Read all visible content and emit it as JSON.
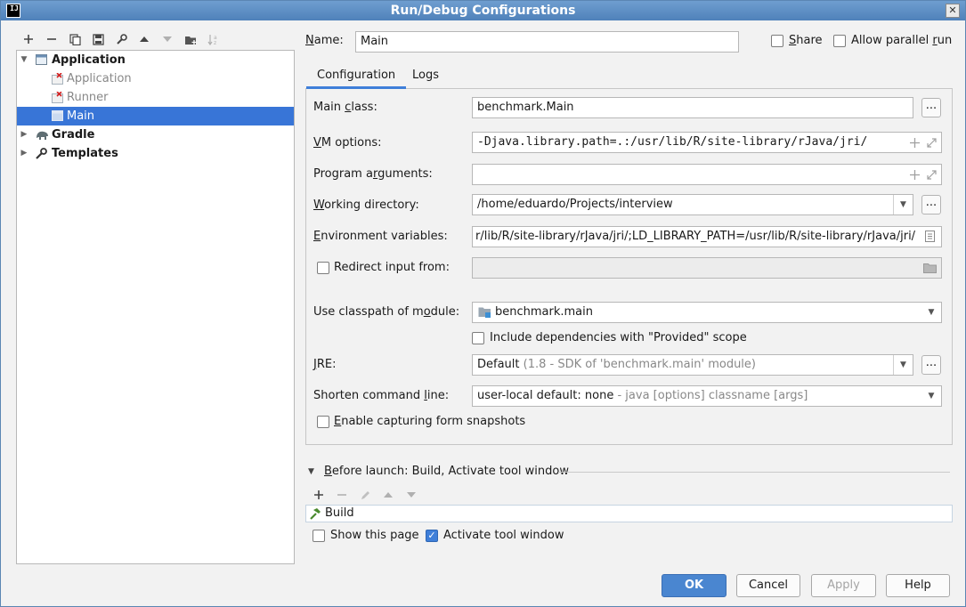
{
  "window": {
    "title": "Run/Debug Configurations",
    "app_icon_text": "IJ",
    "close_glyph": "✕"
  },
  "tree": {
    "items": [
      {
        "label": "Application"
      },
      {
        "label": "Application"
      },
      {
        "label": "Runner"
      },
      {
        "label": "Main"
      },
      {
        "label": "Gradle"
      },
      {
        "label": "Templates"
      }
    ]
  },
  "name": {
    "label_pre": "N",
    "label_post": "ame:",
    "value": "Main"
  },
  "share": {
    "label_pre": "",
    "label_u": "S",
    "label_post": "hare",
    "checked": false
  },
  "parallel": {
    "label_pre": "Allow parallel ",
    "label_u": "r",
    "label_post": "un",
    "checked": false
  },
  "tabs": [
    {
      "label": "Configuration"
    },
    {
      "label": "Logs"
    }
  ],
  "form": {
    "main_class": {
      "label_pre": "Main ",
      "label_u": "c",
      "label_post": "lass:",
      "value": "benchmark.Main"
    },
    "vm_options": {
      "label_u": "V",
      "label_post": "M options:",
      "value": "-Djava.library.path=.:/usr/lib/R/site-library/rJava/jri/"
    },
    "program_args": {
      "label_pre": "Program a",
      "label_u": "r",
      "label_post": "guments:",
      "value": ""
    },
    "working_dir": {
      "label_u": "W",
      "label_post": "orking directory:",
      "value": "/home/eduardo/Projects/interview"
    },
    "env_vars": {
      "label_u": "E",
      "label_post": "nvironment variables:",
      "value": "r/lib/R/site-library/rJava/jri/;LD_LIBRARY_PATH=/usr/lib/R/site-library/rJava/jri/"
    },
    "redirect": {
      "label": "Redirect input from:",
      "checked": false,
      "value": ""
    },
    "classpath": {
      "label_pre": "Use classpath of m",
      "label_u": "o",
      "label_post": "dule:",
      "value": "benchmark.main"
    },
    "include_deps": {
      "label": "Include dependencies with \"Provided\" scope",
      "checked": false
    },
    "jre": {
      "label_u": "J",
      "label_post": "RE:",
      "value": "Default",
      "hint": "(1.8 - SDK of 'benchmark.main' module)"
    },
    "shorten": {
      "label_pre": "Shorten command ",
      "label_u": "l",
      "label_post": "ine:",
      "value": "user-local default: none",
      "hint": "- java [options] classname [args]"
    },
    "snapshots": {
      "label_u": "E",
      "label_post": "nable capturing form snapshots",
      "checked": false
    }
  },
  "before_launch": {
    "label_u": "B",
    "label_post": "efore launch: Build, Activate tool window",
    "items": [
      {
        "label": "Build"
      }
    ],
    "show_page": {
      "label": "Show this page",
      "checked": false
    },
    "activate": {
      "label": "Activate tool window",
      "checked": true
    }
  },
  "buttons": {
    "ok": "OK",
    "cancel": "Cancel",
    "apply": "Apply",
    "help": "Help"
  },
  "glyphs": {
    "dots": "...",
    "arrow_down": "▼",
    "expand_open": "▼",
    "expand_closed": "▶",
    "check": "✓"
  }
}
